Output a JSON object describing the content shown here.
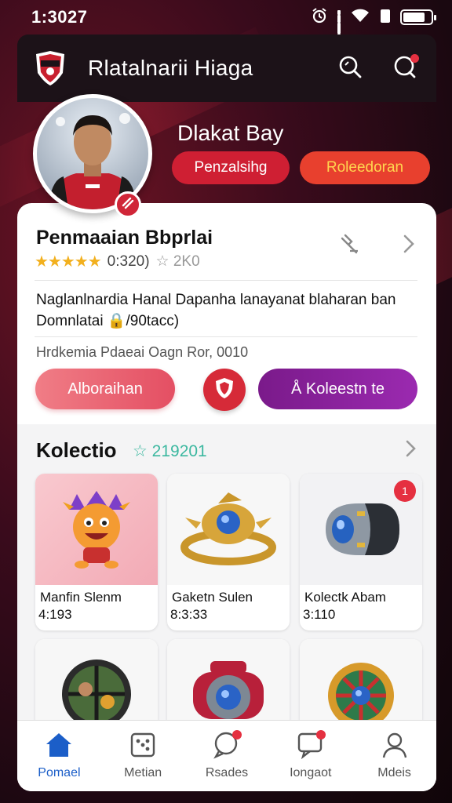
{
  "status": {
    "time": "1:3027",
    "battery_level": 0.8
  },
  "header": {
    "title": "Rlatalnarii Hiaga",
    "logo_icon": "club-crest-icon",
    "search_icon": "search-icon",
    "notification_icon": "notification-bubble-icon"
  },
  "profile": {
    "name": "Dlakat Bay",
    "pill_primary": "Penzalsihg",
    "pill_secondary": "Roleedoran"
  },
  "card": {
    "title": "Penmaaian Bbprlai",
    "rating_value": "0:320)",
    "rating_stars": "★★★★★",
    "rating_filled": 4.5,
    "rating_secondary": "☆ 2K0",
    "description": "Naglanlnardia Hanal Dapanha lanayanat blaharan ban Domnlatai 🔒/90tacc)",
    "meta": "Hrdkemia Pdaeai Oagn Ror, 0010",
    "button_primary": "Alboraihan",
    "button_secondary": "Å Koleestn te"
  },
  "collection": {
    "title": "Kolectio",
    "count": "☆ 219201",
    "items": [
      {
        "name": "Manfin Slenm",
        "value": "4:193",
        "badge": "",
        "icon": "mascot-character-icon"
      },
      {
        "name": "Gaketn Sulen",
        "value": "8:3:33",
        "badge": "",
        "icon": "golden-ring-icon"
      },
      {
        "name": "Kolectk Abam",
        "value": "3:110",
        "badge": "1",
        "icon": "capsule-pod-icon"
      },
      {
        "name": "",
        "value": "",
        "badge": "",
        "icon": "portrait-coin-icon"
      },
      {
        "name": "",
        "value": "",
        "badge": "",
        "icon": "mech-wheel-icon"
      },
      {
        "name": "",
        "value": "",
        "badge": "",
        "icon": "rune-wheel-icon"
      }
    ]
  },
  "nav": [
    {
      "label": "Pomael",
      "icon": "home-icon",
      "active": true
    },
    {
      "label": "Metian",
      "icon": "dice-icon",
      "active": false
    },
    {
      "label": "Rsades",
      "icon": "chat-bubble-icon",
      "active": false
    },
    {
      "label": "Iongaot",
      "icon": "message-icon",
      "active": false
    },
    {
      "label": "Mdeis",
      "icon": "profile-icon",
      "active": false
    }
  ],
  "colors": {
    "brand_red": "#d02638",
    "accent_purple": "#8a22a0",
    "active_blue": "#1b5ec8",
    "pill_text_gold": "#ffd54f"
  }
}
